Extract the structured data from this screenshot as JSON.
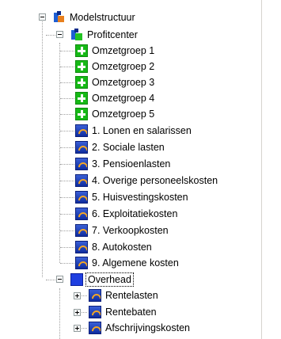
{
  "tree": {
    "root": {
      "label": "Modelstructuur",
      "icon": "model-structure-icon",
      "expanded": true
    },
    "profitcenter": {
      "label": "Profitcenter",
      "icon": "profitcenter-icon",
      "expanded": true,
      "children": [
        {
          "label": "Omzetgroep 1",
          "icon": "green-plus-icon"
        },
        {
          "label": "Omzetgroep 2",
          "icon": "green-plus-icon"
        },
        {
          "label": "Omzetgroep 3",
          "icon": "green-plus-icon"
        },
        {
          "label": "Omzetgroep 4",
          "icon": "green-plus-icon"
        },
        {
          "label": "Omzetgroep 5",
          "icon": "green-plus-icon"
        },
        {
          "label": "1. Lonen en salarissen",
          "icon": "cost-icon"
        },
        {
          "label": "2. Sociale lasten",
          "icon": "cost-icon"
        },
        {
          "label": "3. Pensioenlasten",
          "icon": "cost-icon"
        },
        {
          "label": "4. Overige personeelskosten",
          "icon": "cost-icon"
        },
        {
          "label": "5. Huisvestingskosten",
          "icon": "cost-icon"
        },
        {
          "label": "6. Exploitatiekosten",
          "icon": "cost-icon"
        },
        {
          "label": "7. Verkoopkosten",
          "icon": "cost-icon"
        },
        {
          "label": "8. Autokosten",
          "icon": "cost-icon"
        },
        {
          "label": "9. Algemene kosten",
          "icon": "cost-icon"
        }
      ]
    },
    "overhead": {
      "label": "Overhead",
      "icon": "overhead-icon",
      "expanded": true,
      "selected": true,
      "children": [
        {
          "label": "Rentelasten",
          "icon": "cost-icon",
          "expanded": false
        },
        {
          "label": "Rentebaten",
          "icon": "cost-icon",
          "expanded": false
        },
        {
          "label": "Afschrijvingskosten",
          "icon": "cost-icon",
          "expanded": false
        }
      ]
    }
  },
  "colors": {
    "selection_border": "#000000",
    "tree_lines": "#a0a0a0",
    "cost_icon": "#0f2d9f",
    "omzet_icon": "#16b916"
  }
}
